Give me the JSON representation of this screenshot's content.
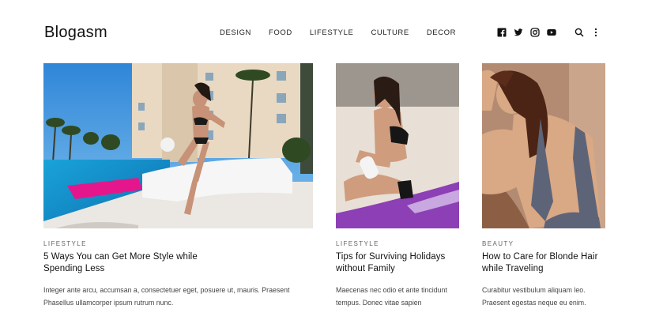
{
  "brand": {
    "logo": "Blogasm"
  },
  "nav": [
    "DESIGN",
    "FOOD",
    "LIFESTYLE",
    "CULTURE",
    "DECOR"
  ],
  "header_icons": [
    "facebook-icon",
    "twitter-icon",
    "instagram-icon",
    "youtube-icon",
    "search-icon",
    "more-vertical-icon"
  ],
  "posts": [
    {
      "category": "LIFESTYLE",
      "title": "5 Ways You can Get More Style while Spending Less",
      "excerpt": "Integer ante arcu, accumsan a, consectetuer eget, posuere ut, mauris. Praesent Phasellus ullamcorper ipsum rutrum nunc."
    },
    {
      "category": "LIFESTYLE",
      "title": "Tips for Surviving Holidays without Family",
      "excerpt": "Maecenas nec odio et ante tincidunt tempus. Donec vitae sapien"
    },
    {
      "category": "BEAUTY",
      "title": "How to Care for Blonde Hair while Traveling",
      "excerpt": "Curabitur vestibulum aliquam leo. Praesent egestas neque eu enim."
    }
  ]
}
